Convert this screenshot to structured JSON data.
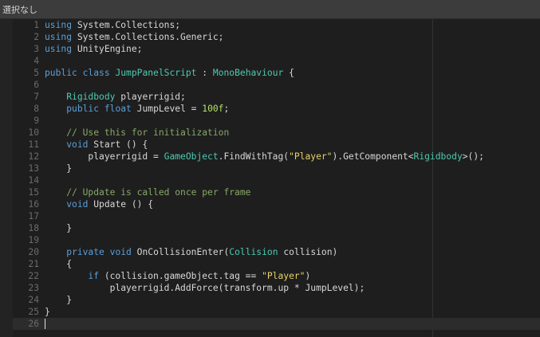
{
  "titlebar": {
    "selection_status": "選択なし"
  },
  "editor": {
    "lines": [
      {
        "num": "1",
        "tokens": [
          {
            "t": "kw",
            "v": "using"
          },
          {
            "t": "",
            "v": " System.Collections;"
          }
        ]
      },
      {
        "num": "2",
        "tokens": [
          {
            "t": "kw",
            "v": "using"
          },
          {
            "t": "",
            "v": " System.Collections.Generic;"
          }
        ]
      },
      {
        "num": "3",
        "tokens": [
          {
            "t": "kw",
            "v": "using"
          },
          {
            "t": "",
            "v": " UnityEngine;"
          }
        ]
      },
      {
        "num": "4",
        "tokens": []
      },
      {
        "num": "5",
        "tokens": [
          {
            "t": "kw",
            "v": "public"
          },
          {
            "t": "",
            "v": " "
          },
          {
            "t": "kw",
            "v": "class"
          },
          {
            "t": "",
            "v": " "
          },
          {
            "t": "ty",
            "v": "JumpPanelScript"
          },
          {
            "t": "",
            "v": " : "
          },
          {
            "t": "ty",
            "v": "MonoBehaviour"
          },
          {
            "t": "",
            "v": " {"
          }
        ]
      },
      {
        "num": "6",
        "tokens": []
      },
      {
        "num": "7",
        "tokens": [
          {
            "t": "",
            "v": "    "
          },
          {
            "t": "ty",
            "v": "Rigidbody"
          },
          {
            "t": "",
            "v": " playerrigid;"
          }
        ]
      },
      {
        "num": "8",
        "tokens": [
          {
            "t": "",
            "v": "    "
          },
          {
            "t": "kw",
            "v": "public"
          },
          {
            "t": "",
            "v": " "
          },
          {
            "t": "kw",
            "v": "float"
          },
          {
            "t": "",
            "v": " JumpLevel = "
          },
          {
            "t": "nu",
            "v": "100f"
          },
          {
            "t": "",
            "v": ";"
          }
        ]
      },
      {
        "num": "9",
        "tokens": []
      },
      {
        "num": "10",
        "tokens": [
          {
            "t": "",
            "v": "    "
          },
          {
            "t": "cm",
            "v": "// Use this for initialization"
          }
        ]
      },
      {
        "num": "11",
        "tokens": [
          {
            "t": "",
            "v": "    "
          },
          {
            "t": "kw",
            "v": "void"
          },
          {
            "t": "",
            "v": " Start () {"
          }
        ]
      },
      {
        "num": "12",
        "tokens": [
          {
            "t": "",
            "v": "        playerrigid = "
          },
          {
            "t": "ty",
            "v": "GameObject"
          },
          {
            "t": "",
            "v": ".FindWithTag("
          },
          {
            "t": "st",
            "v": "\"Player\""
          },
          {
            "t": "",
            "v": ").GetComponent<"
          },
          {
            "t": "ty",
            "v": "Rigidbody"
          },
          {
            "t": "",
            "v": ">();"
          }
        ]
      },
      {
        "num": "13",
        "tokens": [
          {
            "t": "",
            "v": "    }"
          }
        ]
      },
      {
        "num": "14",
        "tokens": []
      },
      {
        "num": "15",
        "tokens": [
          {
            "t": "",
            "v": "    "
          },
          {
            "t": "cm",
            "v": "// Update is called once per frame"
          }
        ]
      },
      {
        "num": "16",
        "tokens": [
          {
            "t": "",
            "v": "    "
          },
          {
            "t": "kw",
            "v": "void"
          },
          {
            "t": "",
            "v": " Update () {"
          }
        ]
      },
      {
        "num": "17",
        "tokens": []
      },
      {
        "num": "18",
        "tokens": [
          {
            "t": "",
            "v": "    }"
          }
        ]
      },
      {
        "num": "19",
        "tokens": []
      },
      {
        "num": "20",
        "tokens": [
          {
            "t": "",
            "v": "    "
          },
          {
            "t": "kw",
            "v": "private"
          },
          {
            "t": "",
            "v": " "
          },
          {
            "t": "kw",
            "v": "void"
          },
          {
            "t": "",
            "v": " OnCollisionEnter("
          },
          {
            "t": "ty",
            "v": "Collision"
          },
          {
            "t": "",
            "v": " collision)"
          }
        ]
      },
      {
        "num": "21",
        "tokens": [
          {
            "t": "",
            "v": "    {"
          }
        ]
      },
      {
        "num": "22",
        "tokens": [
          {
            "t": "",
            "v": "        "
          },
          {
            "t": "kw",
            "v": "if"
          },
          {
            "t": "",
            "v": " (collision.gameObject.tag == "
          },
          {
            "t": "st",
            "v": "\"Player\""
          },
          {
            "t": "",
            "v": ")"
          }
        ]
      },
      {
        "num": "23",
        "tokens": [
          {
            "t": "",
            "v": "            playerrigid.AddForce(transform.up * JumpLevel);"
          }
        ]
      },
      {
        "num": "24",
        "tokens": [
          {
            "t": "",
            "v": "    }"
          }
        ]
      },
      {
        "num": "25",
        "tokens": [
          {
            "t": "",
            "v": "}"
          }
        ]
      },
      {
        "num": "26",
        "tokens": [],
        "current": true
      }
    ]
  },
  "colors": {
    "keyword": "#5c9fd6",
    "type": "#4ec9b0",
    "comment": "#87a868",
    "string": "#e6d26a",
    "number": "#b5e06a",
    "text": "#d8d8d8",
    "line_number": "#6b6b6b",
    "background": "#1e1e1e"
  }
}
